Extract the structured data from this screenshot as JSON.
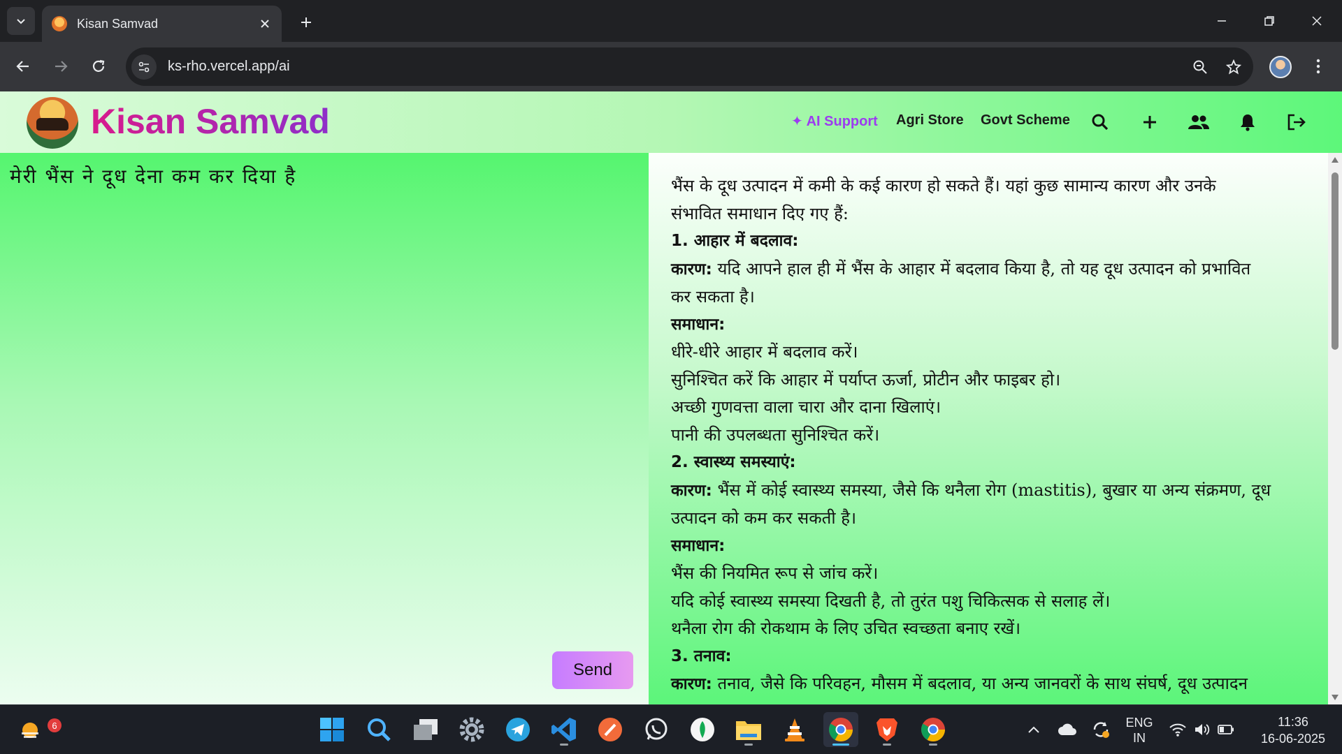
{
  "browser": {
    "tab_title": "Kisan Samvad",
    "url": "ks-rho.vercel.app/ai"
  },
  "header": {
    "brand": "Kisan Samvad",
    "nav": {
      "ai_support": "AI Support",
      "agri_store": "Agri Store",
      "govt_scheme": "Govt Scheme"
    }
  },
  "chat": {
    "prompt": "मेरी भैंस ने दूध देना कम कर दिया है",
    "send_label": "Send",
    "answer_lines": [
      "भैंस के दूध उत्पादन में कमी के कई कारण हो सकते हैं। यहां कुछ सामान्य कारण और उनके",
      "संभावित समाधान दिए गए हैं:",
      "1. आहार में बदलाव:",
      "यदि आपने हाल ही में भैंस के आहार में बदलाव किया है, तो यह दूध उत्पादन को प्रभावित",
      "कर सकता है।",
      "समाधान:",
      "धीरे-धीरे आहार में बदलाव करें।",
      "सुनिश्चित करें कि आहार में पर्याप्त ऊर्जा, प्रोटीन और फाइबर हो।",
      "अच्छी गुणवत्ता वाला चारा और दाना खिलाएं।",
      "पानी की उपलब्धता सुनिश्चित करें।",
      "2. स्वास्थ्य समस्याएं:",
      "भैंस में कोई स्वास्थ्य समस्या, जैसे कि थनैला रोग (mastitis), बुखार या अन्य संक्रमण, दूध",
      "उत्पादन को कम कर सकती है।",
      "समाधान:",
      "भैंस की नियमित रूप से जांच करें।",
      "यदि कोई स्वास्थ्य समस्या दिखती है, तो तुरंत पशु चिकित्सक से सलाह लें।",
      "थनैला रोग की रोकथाम के लिए उचित स्वच्छता बनाए रखें।",
      "3. तनाव:",
      "तनाव, जैसे कि परिवहन, मौसम में बदलाव, या अन्य जानवरों के साथ संघर्ष, दूध उत्पादन"
    ],
    "cause_label": "कारण:"
  },
  "taskbar": {
    "weather_badge": "6",
    "lang": "ENG",
    "region": "IN",
    "time": "11:36",
    "date": "16-06-2025"
  },
  "colors": {
    "brand_gradient_start": "#d81b8c",
    "brand_gradient_end": "#8e2fc9",
    "accent_purple": "#9c3cf0",
    "send_button": "#d48cf8",
    "page_green": "#55f56f"
  }
}
